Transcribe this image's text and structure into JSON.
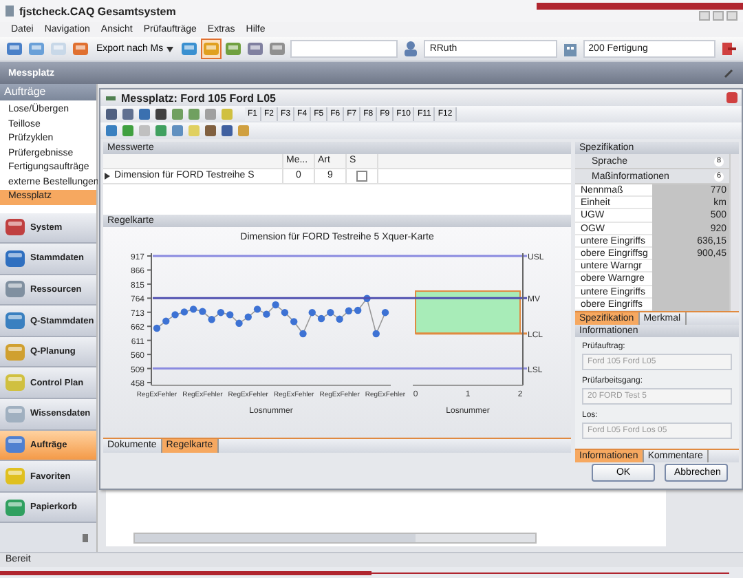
{
  "window": {
    "title": "fjstcheck.CAQ Gesamtsystem"
  },
  "menu": [
    "Datei",
    "Navigation",
    "Ansicht",
    "Prüfaufträge",
    "Extras",
    "Hilfe"
  ],
  "toolbar": {
    "export_button": "Export nach Ms",
    "user_field": "RRuth",
    "department_field": "200 Fertigung"
  },
  "breadcrumb": "Messplatz",
  "sidebar": {
    "title": "Aufträge",
    "items": [
      {
        "label": "Lose/Übergen",
        "selected": false
      },
      {
        "label": "Teillose",
        "selected": false
      },
      {
        "label": "Prüfzyklen",
        "selected": false
      },
      {
        "label": "Prüfergebnisse",
        "selected": false
      },
      {
        "label": "Fertigungsaufträge",
        "selected": false
      },
      {
        "label": "externe Bestellungen",
        "selected": false
      },
      {
        "label": "Messplatz",
        "selected": true
      }
    ],
    "nav_buttons": [
      {
        "label": "System",
        "selected": false
      },
      {
        "label": "Stammdaten",
        "selected": false
      },
      {
        "label": "Ressourcen",
        "selected": false
      },
      {
        "label": "Q-Stammdaten",
        "selected": false
      },
      {
        "label": "Q-Planung",
        "selected": false
      },
      {
        "label": "Control Plan",
        "selected": false
      },
      {
        "label": "Wissensdaten",
        "selected": false
      },
      {
        "label": "Aufträge",
        "selected": true
      },
      {
        "label": "Favoriten",
        "selected": false
      },
      {
        "label": "Papierkorb",
        "selected": false
      }
    ]
  },
  "dialog": {
    "title": "Messplatz: Ford 105 Ford L05",
    "fkeys": [
      "F1",
      "F2",
      "F3",
      "F4",
      "F5",
      "F6",
      "F7",
      "F8",
      "F9",
      "F10",
      "F11",
      "F12"
    ],
    "measurements": {
      "title": "Messwerte",
      "columns": [
        "Me...",
        "Art",
        "S"
      ],
      "rows": [
        {
          "name": "Dimension für FORD Testreihe S",
          "values": [
            "0",
            "9"
          ],
          "checked": false
        }
      ]
    },
    "control_chart": {
      "panel_title": "Regelkarte",
      "chart_data": {
        "type": "line",
        "title": "Dimension für FORD Testreihe 5  Xquer-Karte",
        "xlabel": "Losnummer",
        "categories": [
          "RegExFehler",
          null,
          null,
          null,
          null,
          "RegExFehler",
          null,
          null,
          null,
          null,
          "RegExFehler",
          null,
          null,
          null,
          null,
          "RegExFehler",
          null,
          null,
          null,
          null,
          "RegExFehler",
          null,
          null,
          null,
          null,
          "RegExFehler"
        ],
        "series": [
          {
            "color": "#3d72d4",
            "marker": "o",
            "values": [
              655,
              681,
              704,
              714,
              724,
              716,
              687,
              712,
              704,
              673,
              696,
              724,
              706,
              740,
              712,
              679,
              635,
              712,
              690,
              712,
              688,
              718,
              720,
              763,
              635,
              712
            ]
          }
        ],
        "ylim": [
          458,
          917
        ],
        "yticks": [
          917,
          866,
          815,
          764,
          713,
          662,
          611,
          560,
          509,
          458
        ],
        "ref_lines": [
          {
            "axis": "y",
            "value": 917,
            "label": "USL"
          },
          {
            "axis": "y",
            "value": 764,
            "label": "MV"
          },
          {
            "axis": "y",
            "value": 636,
            "label": "LCL"
          },
          {
            "axis": "y",
            "value": 509,
            "label": "LSL"
          }
        ]
      },
      "limits_panel": {
        "xticks": [
          "0",
          "1",
          "2"
        ],
        "xlabel": "Losnummer"
      }
    },
    "bottom_tabs": [
      {
        "label": "Dokumente",
        "selected": false
      },
      {
        "label": "Regelkarte",
        "selected": true
      }
    ],
    "specification": {
      "title": "Spezifikation",
      "groups": [
        {
          "label": "Sprache",
          "count": "8"
        },
        {
          "label": "Maßinformationen",
          "count": "6"
        }
      ],
      "rows": [
        {
          "name": "Nennmaß",
          "value": "770"
        },
        {
          "name": "Einheit",
          "value": "km"
        },
        {
          "name": "UGW",
          "value": "500"
        },
        {
          "name": "OGW",
          "value": "920"
        },
        {
          "name": "untere Eingriffs",
          "value": "636,15"
        },
        {
          "name": "obere Eingriffsg",
          "value": "900,45"
        },
        {
          "name": "untere Warngr"
        },
        {
          "name": "obere Warngre"
        },
        {
          "name": "untere Eingriffs"
        },
        {
          "name": "obere Eingriffs"
        }
      ],
      "tabs": [
        {
          "label": "Spezifikation",
          "selected": true
        },
        {
          "label": "Merkmal",
          "selected": false
        }
      ]
    },
    "information": {
      "title": "Informationen",
      "fields": [
        {
          "label": "Prüfauftrag:",
          "value": "Ford 105 Ford L05",
          "disabled": true
        },
        {
          "label": "Prüfarbeitsgang:",
          "value": "20 FORD Test 5",
          "disabled": true
        },
        {
          "label": "Los:",
          "value": "Ford L05 Ford Los 05",
          "disabled": true
        }
      ],
      "tabs": [
        {
          "label": "Informationen",
          "selected": true
        },
        {
          "label": "Kommentare",
          "selected": false
        }
      ]
    },
    "buttons": [
      "OK",
      "Abbrechen"
    ]
  },
  "status_bar": "Bereit"
}
